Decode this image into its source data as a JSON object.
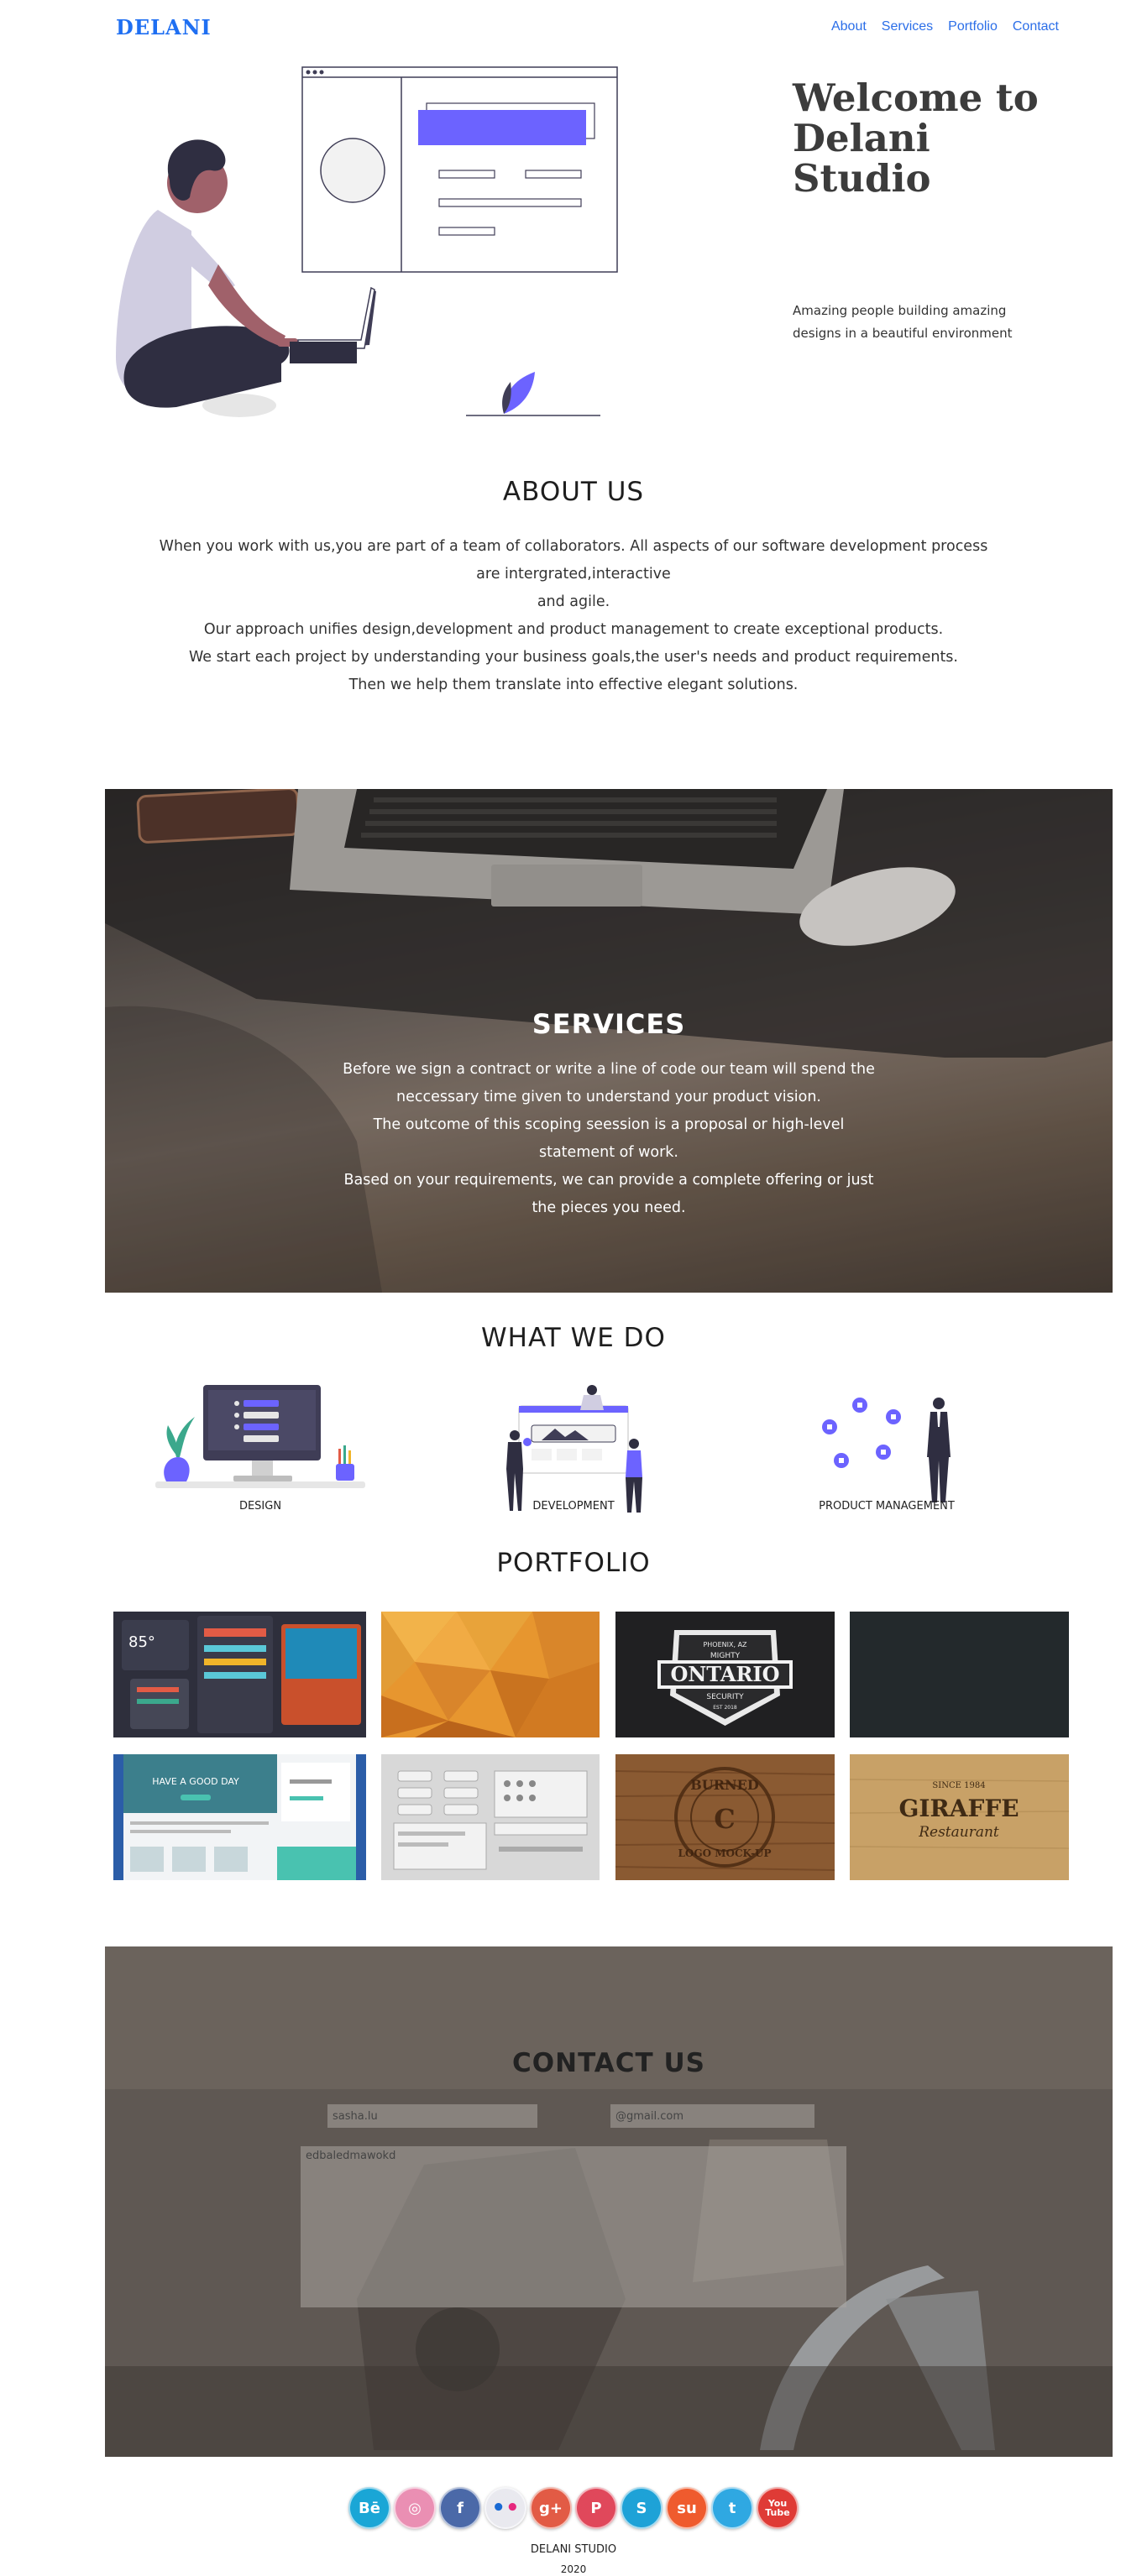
{
  "nav": {
    "brand": "DELANI",
    "links": [
      "About",
      "Services",
      "Portfolio",
      "Contact"
    ]
  },
  "hero": {
    "title": "Welcome to Delani Studio",
    "subtitle": "Amazing people building amazing designs in a beautiful environment"
  },
  "about": {
    "title": "ABOUT US",
    "lines": [
      "When you work with us,you are part of a team of collaborators. All aspects of our software development process are intergrated,interactive",
      "and agile.",
      "Our approach unifies design,development and product management to create exceptional products.",
      "We start each project by understanding your business goals,the user's needs and product requirements.",
      "Then we help them translate into effective elegant solutions."
    ]
  },
  "services": {
    "title": "SERVICES",
    "lines": [
      "Before we sign a contract or write a line of code our team will spend the neccessary time given to understand your product vision.",
      "The outcome of this scoping seession is a proposal or high-level statement of work.",
      "Based on your requirements, we can provide a complete offering or just the pieces you need."
    ]
  },
  "what_we_do": {
    "title": "WHAT WE DO",
    "items": [
      "DESIGN",
      "DEVELOPMENT",
      "PRODUCT MANAGEMENT"
    ]
  },
  "portfolio": {
    "title": "PORTFOLIO",
    "image_texts": {
      "ontario_top": "PHOENIX, AZ",
      "ontario_small": "MIGHTY",
      "ontario_main": "ONTARIO",
      "ontario_sub": "SECURITY",
      "ontario_est": "EST 2018",
      "day_banner": "HAVE A GOOD DAY",
      "burned": "BURNED",
      "logo_mockup": "LOGO MOCK-UP",
      "giraffe_top": "SINCE 1984",
      "giraffe_main": "GIRAFFE",
      "giraffe_sub": "Restaurant"
    }
  },
  "contact": {
    "title": "CONTACT US",
    "name_value": "sasha.lu",
    "email_value": "@gmail.com",
    "message_value": "edbaledmawokd"
  },
  "footer": {
    "socials": [
      {
        "icon": "behance-icon",
        "label": "Bē",
        "color": "#1aa6d6"
      },
      {
        "icon": "dribbble-icon",
        "label": "◎",
        "color": "#ea8fb3"
      },
      {
        "icon": "facebook-icon",
        "label": "f",
        "color": "#4b69a8"
      },
      {
        "icon": "flickr-icon",
        "label": "••",
        "color": "#e9e9ef"
      },
      {
        "icon": "google-plus-icon",
        "label": "g+",
        "color": "#e25b45"
      },
      {
        "icon": "pinterest-icon",
        "label": "P",
        "color": "#e0485b"
      },
      {
        "icon": "skype-icon",
        "label": "S",
        "color": "#1ea2d7"
      },
      {
        "icon": "stumbleupon-icon",
        "label": "su",
        "color": "#ef5b2e"
      },
      {
        "icon": "twitter-icon",
        "label": "t",
        "color": "#2fa8e2"
      },
      {
        "icon": "youtube-icon",
        "label": "You Tube",
        "color": "#df3b36"
      }
    ],
    "name": "DELANI STUDIO",
    "year": "2020"
  },
  "colors": {
    "brand": "#1f6ff2",
    "accent_purple": "#6c63ff",
    "nav_link": "#2b6ee8"
  }
}
